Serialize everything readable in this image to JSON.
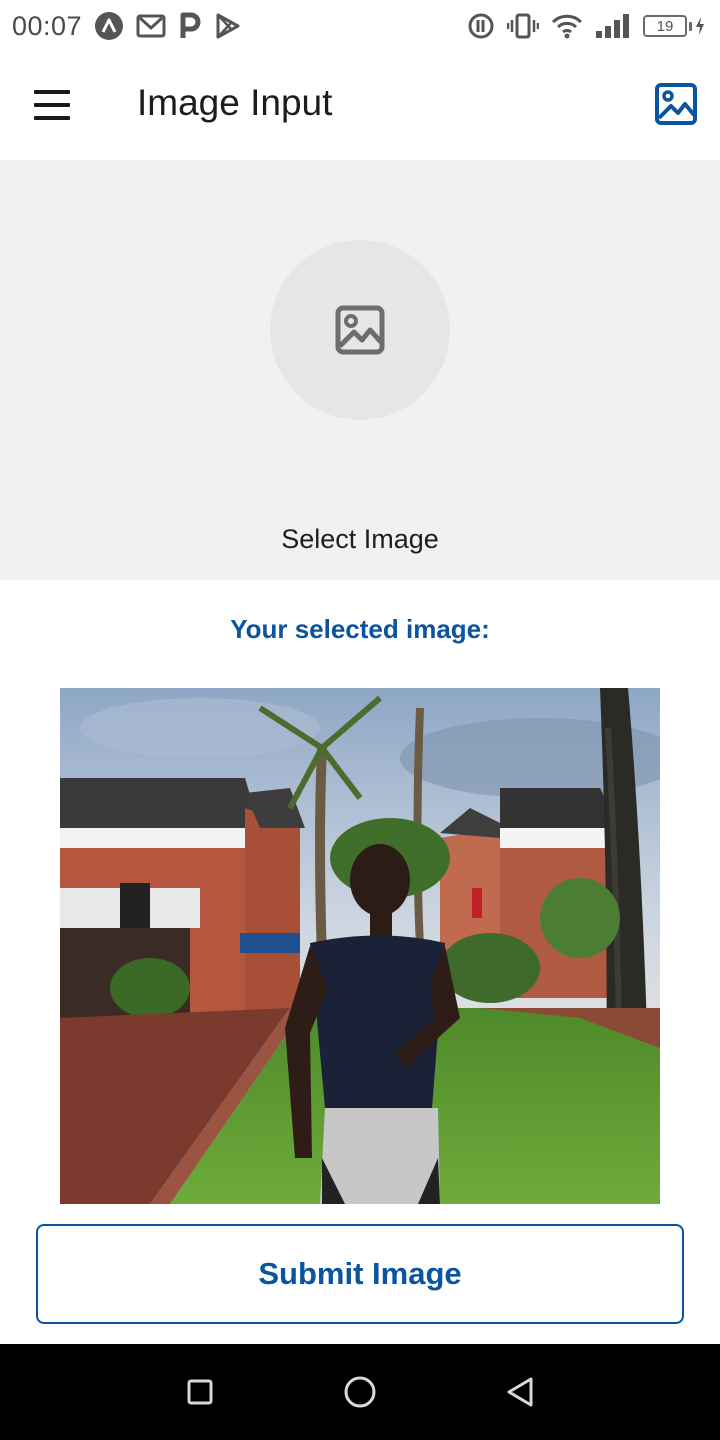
{
  "status_bar": {
    "time": "00:07",
    "left_icons": [
      "app-a-icon",
      "gmail-icon",
      "parking-p-icon",
      "play-store-icon"
    ],
    "right_icons": [
      "data-saver-icon",
      "vibrate-icon",
      "wifi-icon",
      "signal-icon"
    ],
    "battery_level": "19"
  },
  "app_bar": {
    "title": "Image Input",
    "menu_icon": "hamburger-menu-icon",
    "action_icon": "image-icon"
  },
  "picker": {
    "label": "Select Image",
    "icon": "image-placeholder-icon"
  },
  "selected": {
    "heading": "Your selected image:"
  },
  "submit": {
    "label": "Submit Image"
  },
  "nav_bar": {
    "buttons": [
      "recents-square-icon",
      "home-circle-icon",
      "back-triangle-icon"
    ]
  },
  "colors": {
    "accent": "#0a54a0",
    "picker_bg": "#f1f1f1",
    "circle_bg": "#e6e6e6",
    "nav_bg": "#000000"
  }
}
